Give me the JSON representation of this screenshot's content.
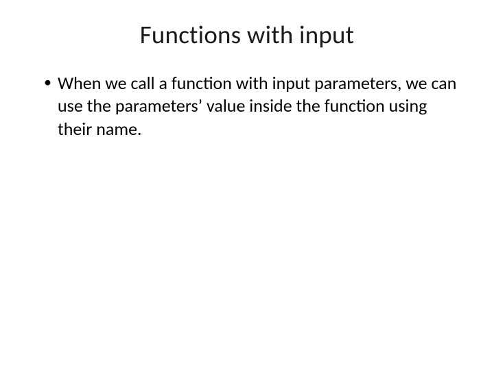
{
  "slide": {
    "title": "Functions with input",
    "bullets": [
      "When we call a function with input parameters, we can use the parameters’ value inside the function using their name."
    ]
  }
}
